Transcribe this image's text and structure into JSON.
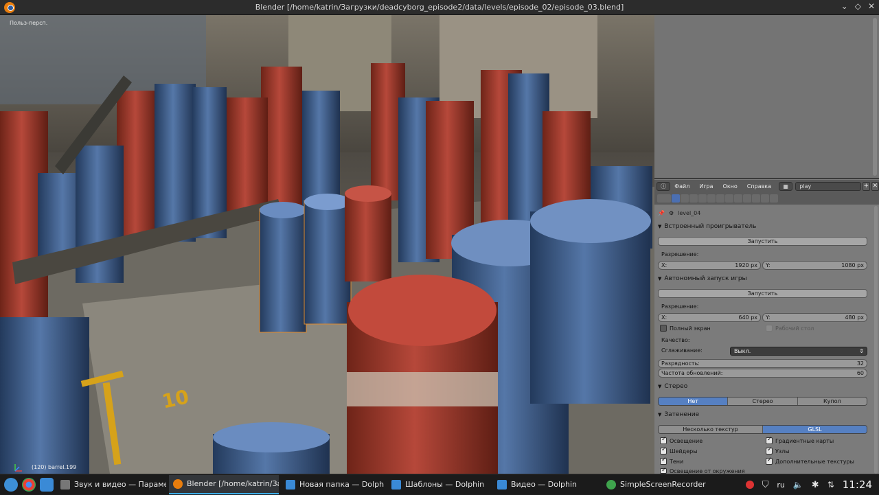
{
  "window": {
    "title": "Blender [/home/katrin/Загрузки/deadcyborg_episode2/data/levels/episode_02/episode_03.blend]"
  },
  "viewport": {
    "view_label": "Польз-персп.",
    "object_label": "(120) barrel.199",
    "floor_number": "10"
  },
  "menubar": {
    "items": [
      "Файл",
      "Игра",
      "Окно",
      "Справка"
    ],
    "screen_name": "play"
  },
  "properties": {
    "context": "level_04",
    "embedded_player": {
      "title": "Встроенный проигрыватель",
      "start_button": "Запустить",
      "resolution_label": "Разрешение:",
      "x_label": "X:",
      "x_value": "1920 px",
      "y_label": "Y:",
      "y_value": "1080 px"
    },
    "standalone": {
      "title": "Автономный запуск игры",
      "start_button": "Запустить",
      "resolution_label": "Разрешение:",
      "x_label": "X:",
      "x_value": "640 px",
      "y_label": "Y:",
      "y_value": "480 px",
      "fullscreen_label": "Полный экран",
      "desktop_label": "Рабочий стол",
      "quality_label": "Качество:",
      "antialias_label": "Сглаживание:",
      "antialias_value": "Выкл.",
      "bit_depth_label": "Разрядность:",
      "bit_depth_value": "32",
      "refresh_label": "Частота обновлений:",
      "refresh_value": "60"
    },
    "stereo": {
      "title": "Стерео",
      "options": [
        "Нет",
        "Стерео",
        "Купол"
      ],
      "selected": "Нет"
    },
    "shading": {
      "title": "Затенение",
      "options": [
        "Несколько текстур",
        "GLSL"
      ],
      "selected": "GLSL",
      "checkboxes": [
        {
          "label": "Освещение",
          "checked": true
        },
        {
          "label": "Градиентные карты",
          "checked": true
        },
        {
          "label": "Шейдеры",
          "checked": true
        },
        {
          "label": "Узлы",
          "checked": true
        },
        {
          "label": "Тени",
          "checked": true
        },
        {
          "label": "Дополнительные текстуры",
          "checked": true
        }
      ],
      "partial_label": "Освещение от окружения"
    }
  },
  "taskbar": {
    "tasks": [
      {
        "label": "Звук и видео — Параметры...",
        "active": false
      },
      {
        "label": "Blender [/home/katrin/Загру...",
        "active": true
      },
      {
        "label": "Новая папка — Dolphin",
        "active": false
      },
      {
        "label": "Шаблоны — Dolphin",
        "active": false
      },
      {
        "label": "Видео — Dolphin",
        "active": false
      },
      {
        "label": "SimpleScreenRecorder",
        "active": false
      }
    ],
    "keyboard_layout": "ru",
    "clock": "11:24"
  },
  "colors": {
    "accent": "#5680c2",
    "taskbar_highlight": "#3daee9",
    "panel_bg": "#7b7b7b",
    "barrel_red": "#a33a2c",
    "barrel_blue": "#3f5f92"
  }
}
